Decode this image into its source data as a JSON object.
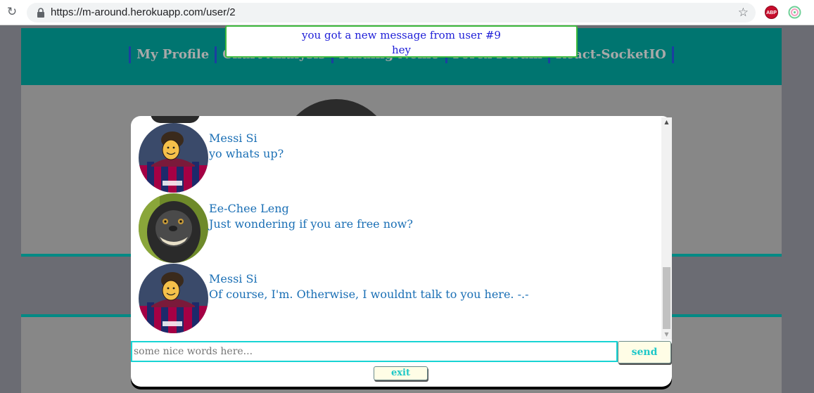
{
  "browser": {
    "url": "https://m-around.herokuapp.com/user/2",
    "extensions": [
      "reload-icon",
      "lock-icon",
      "bookmark-star-icon",
      "adblock-plus-icon",
      "extension-icon"
    ],
    "abp_label": "ABP"
  },
  "nav": {
    "items": [
      {
        "label": "My Profile"
      },
      {
        "label": "Chart Analysis"
      },
      {
        "label": "Finding Nemo"
      },
      {
        "label": "Forex Forum"
      },
      {
        "label": "React-SocketIO"
      }
    ]
  },
  "notification": {
    "line1": "you got a new message from user #9",
    "line2": "hey"
  },
  "chat": {
    "messages": [
      {
        "name": "Messi Si",
        "text": "yo whats up?",
        "avatar": "messi-avatar"
      },
      {
        "name": "Ee-Chee Leng",
        "text": "Just wondering if you are free now?",
        "avatar": "monkey-avatar"
      },
      {
        "name": "Messi Si",
        "text": "Of course, I'm. Otherwise, I wouldnt talk to you here. -.-",
        "avatar": "messi-avatar"
      }
    ],
    "input_placeholder": "some nice words here...",
    "send_label": "send",
    "exit_label": "exit"
  },
  "colors": {
    "nav_bg": "#007570",
    "toast_text": "#2020d8",
    "toast_border": "#3cb93c",
    "message_text": "#1a6fb5",
    "input_border": "#18d4d4",
    "button_text": "#1ec8c8"
  }
}
